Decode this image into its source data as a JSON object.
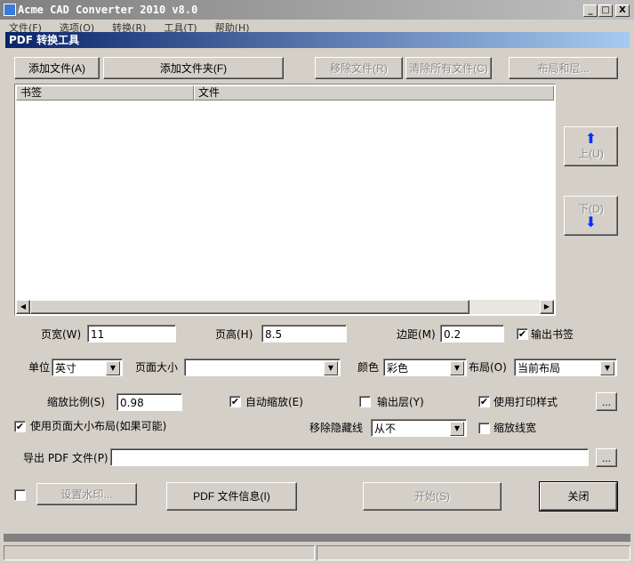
{
  "window": {
    "title": "Acme CAD Converter 2010 v8.0",
    "min": "_",
    "max": "□",
    "close": "X"
  },
  "menu": [
    "文件(F)",
    "选项(O)",
    "转换(R)",
    "工具(T)",
    "帮助(H)"
  ],
  "dialog": {
    "title": "PDF 转换工具"
  },
  "toolbar": {
    "add_file": "添加文件(A)",
    "add_folder": "添加文件夹(F)",
    "remove_file": "移除文件(R)",
    "clear_all": "清除所有文件(C)",
    "layouts": "布局和层..."
  },
  "list": {
    "columns": [
      "书签",
      "文件"
    ],
    "rows": []
  },
  "side": {
    "up": "上(U)",
    "down": "下(D)",
    "up_arrow": "⬆",
    "down_arrow": "⬇"
  },
  "form": {
    "page_width_label": "页宽(W)",
    "page_width": "11",
    "page_height_label": "页高(H)",
    "page_height": "8.5",
    "margin_label": "边距(M)",
    "margin": "0.2",
    "output_bookmark": "输出书签",
    "unit_label": "单位",
    "unit": "英寸",
    "page_size_label": "页面大小",
    "page_size": "",
    "color_label": "颜色",
    "color": "彩色",
    "layout_label": "布局(O)",
    "layout": "当前布局",
    "scale_label": "缩放比例(S)",
    "scale": "0.98",
    "auto_scale": "自动缩放(E)",
    "output_layers": "输出层(Y)",
    "use_plot_style": "使用打印样式",
    "ellipsis": "...",
    "use_page_layout": "使用页面大小布局(如果可能)",
    "remove_hidden_label": "移除隐藏线",
    "remove_hidden": "从不",
    "scale_lineweight": "缩放线宽",
    "export_label": "导出 PDF 文件(P)",
    "export_path": ""
  },
  "bottom": {
    "watermark": "设置水印...",
    "pdf_info": "PDF 文件信息(I)",
    "start": "开始(S)",
    "close": "关闭"
  },
  "checks": {
    "output_bookmark": true,
    "auto_scale": true,
    "output_layers": false,
    "use_plot_style": true,
    "use_page_layout": true,
    "scale_lineweight": false,
    "watermark": false
  }
}
